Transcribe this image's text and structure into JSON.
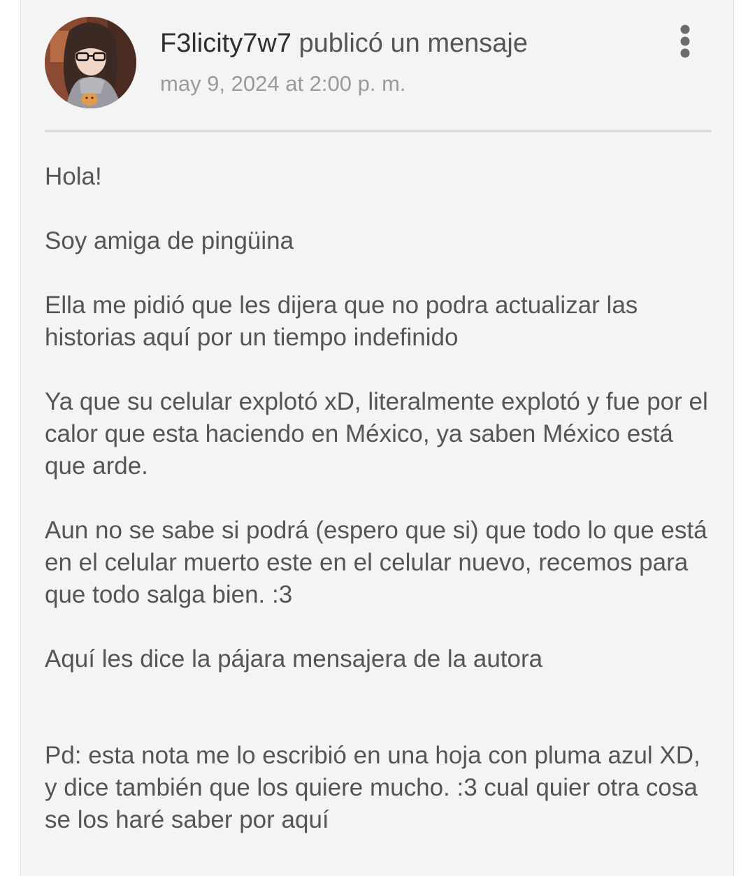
{
  "post": {
    "username": "F3licity7w7",
    "action": "publicó un mensaje",
    "timestamp": "may 9, 2024 at 2:00 p. m.",
    "avatar_icon": "user-avatar-anime-girl-with-glasses",
    "more_icon": "more-vertical-icon",
    "paragraphs": [
      "Hola!",
      "Soy amiga de pingüina",
      "Ella me pidió que les dijera que no podra actualizar las historias aquí por un tiempo indefinido",
      "Ya que su celular explotó xD, literalmente explotó y fue por el calor que esta haciendo en México, ya saben México está que arde.",
      "Aun no se sabe si podrá (espero que si) que todo lo que está en el celular muerto este en el celular nuevo, recemos para que todo salga bien. :3",
      "Aquí les dice la pájara mensajera de la autora",
      "Pd: esta nota me lo escribió en una hoja con pluma azul XD, y dice también que los quiere mucho. :3 cual quier otra cosa se los haré saber por aquí"
    ]
  },
  "colors": {
    "card_background": "#f4f4f4",
    "text": "#555555",
    "username": "#2e2e2e",
    "timestamp": "#9a9a9a",
    "divider": "#d9d9d9",
    "icon": "#6b6b6b"
  }
}
